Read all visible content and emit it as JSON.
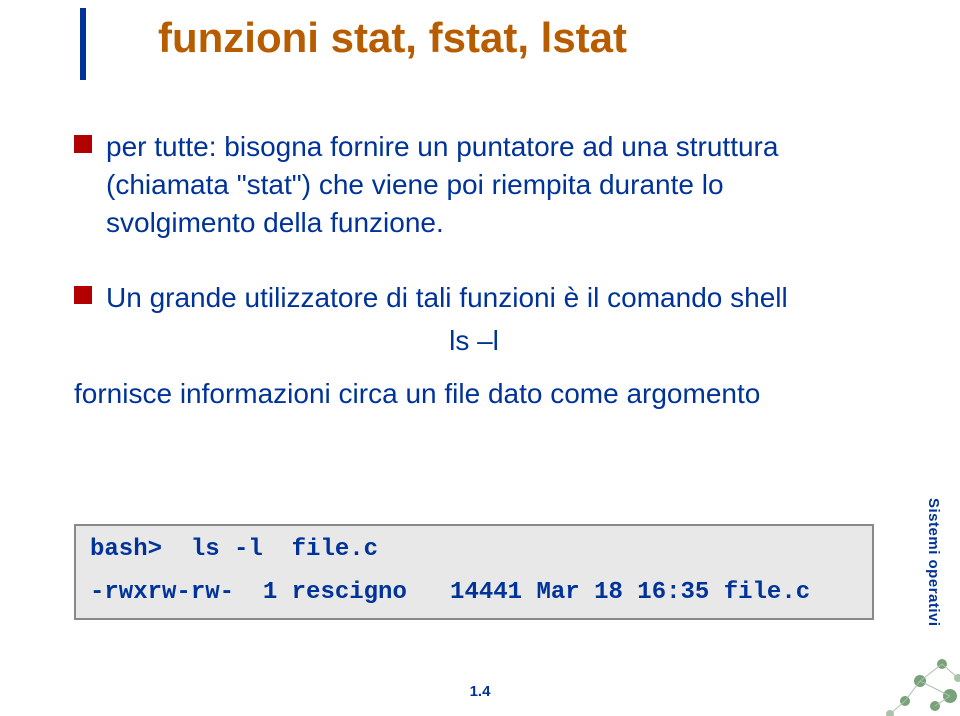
{
  "title": "funzioni stat, fstat, lstat",
  "bullet1": "per tutte: bisogna fornire un puntatore ad una struttura (chiamata \"stat\") che viene poi riempita durante lo svolgimento della funzione.",
  "bullet2": "Un grande utilizzatore di tali funzioni è il comando shell",
  "cmd_center": "ls –l",
  "tail": "fornisce informazioni circa un file dato come argomento",
  "code": {
    "line1": "bash>  ls -l  file.c",
    "line2": "-rwxrw-rw-  1 rescigno   14441 Mar 18 16:35 file.c"
  },
  "side_label": "Sistemi operativi",
  "page_num": "1.4"
}
